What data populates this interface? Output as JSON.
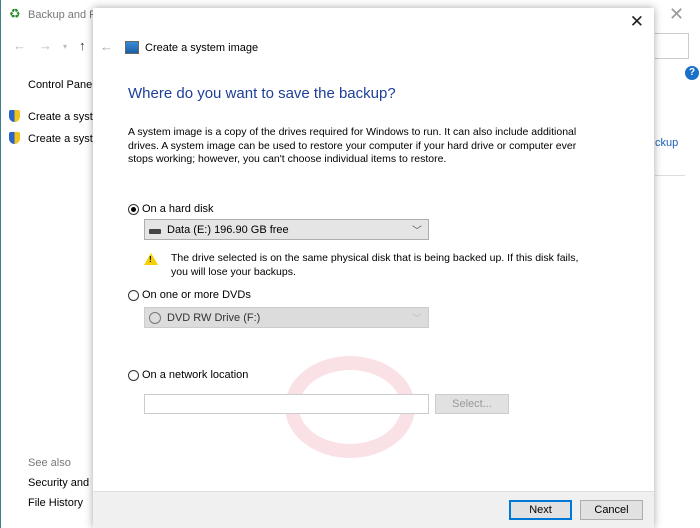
{
  "background_window": {
    "title": "Backup and Re",
    "nav_links": [
      "Control Panel",
      "Create a syste",
      "Create a syste"
    ],
    "right_link": "ckup",
    "see_also": "See also",
    "see_also_links": [
      "Security and M",
      "File History"
    ],
    "help_glyph": "?"
  },
  "dialog": {
    "title": "Create a system image",
    "heading": "Where do you want to save the backup?",
    "description": "A system image is a copy of the drives required for Windows to run. It can also include additional drives. A system image can be used to restore your computer if your hard drive or computer ever stops working; however, you can't choose individual items to restore.",
    "options": {
      "hard_disk": {
        "label": "On a hard disk",
        "selected": true,
        "drive": "Data (E:)  196.90 GB free"
      },
      "warning": "The drive selected is on the same physical disk that is being backed up. If this disk fails, you will lose your backups.",
      "dvd": {
        "label": "On one or more DVDs",
        "selected": false,
        "drive": "DVD RW Drive (F:)"
      },
      "network": {
        "label": "On a network location",
        "selected": false,
        "value": "",
        "select_label": "Select..."
      }
    },
    "buttons": {
      "next": "Next",
      "cancel": "Cancel"
    }
  },
  "colors": {
    "heading": "#1e3f9a",
    "default_button_border": "#0078d7",
    "warning": "#f6d000"
  }
}
